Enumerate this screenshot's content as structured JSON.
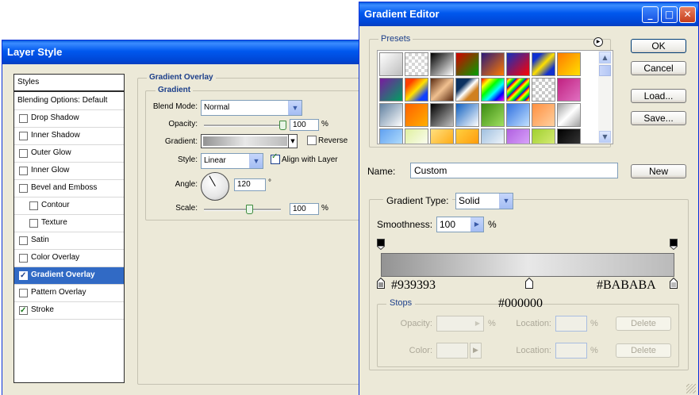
{
  "layer_style": {
    "title": "Layer Style",
    "list": [
      {
        "label": "Styles",
        "checkbox": false,
        "checked": false,
        "selected": false,
        "indent": 0,
        "header": true
      },
      {
        "label": "Blending Options: Default",
        "checkbox": false,
        "checked": false,
        "selected": false,
        "indent": 0,
        "header": false
      },
      {
        "label": "Drop Shadow",
        "checkbox": true,
        "checked": false,
        "selected": false,
        "indent": 0,
        "header": false
      },
      {
        "label": "Inner Shadow",
        "checkbox": true,
        "checked": false,
        "selected": false,
        "indent": 0,
        "header": false
      },
      {
        "label": "Outer Glow",
        "checkbox": true,
        "checked": false,
        "selected": false,
        "indent": 0,
        "header": false
      },
      {
        "label": "Inner Glow",
        "checkbox": true,
        "checked": false,
        "selected": false,
        "indent": 0,
        "header": false
      },
      {
        "label": "Bevel and Emboss",
        "checkbox": true,
        "checked": false,
        "selected": false,
        "indent": 0,
        "header": false
      },
      {
        "label": "Contour",
        "checkbox": true,
        "checked": false,
        "selected": false,
        "indent": 1,
        "header": false
      },
      {
        "label": "Texture",
        "checkbox": true,
        "checked": false,
        "selected": false,
        "indent": 1,
        "header": false
      },
      {
        "label": "Satin",
        "checkbox": true,
        "checked": false,
        "selected": false,
        "indent": 0,
        "header": false
      },
      {
        "label": "Color Overlay",
        "checkbox": true,
        "checked": false,
        "selected": false,
        "indent": 0,
        "header": false
      },
      {
        "label": "Gradient Overlay",
        "checkbox": true,
        "checked": true,
        "selected": true,
        "indent": 0,
        "header": false
      },
      {
        "label": "Pattern Overlay",
        "checkbox": true,
        "checked": false,
        "selected": false,
        "indent": 0,
        "header": false
      },
      {
        "label": "Stroke",
        "checkbox": true,
        "checked": true,
        "selected": false,
        "indent": 0,
        "header": false
      }
    ],
    "section_title": "Gradient Overlay",
    "group_title": "Gradient",
    "blend_mode_label": "Blend Mode:",
    "blend_mode_value": "Normal",
    "opacity_label": "Opacity:",
    "opacity_value": "100",
    "opacity_unit": "%",
    "opacity_level": 1.0,
    "gradient_label": "Gradient:",
    "reverse_label": "Reverse",
    "reverse_checked": false,
    "style_label": "Style:",
    "style_value": "Linear",
    "align_label": "Align with Layer",
    "align_checked": true,
    "angle_label": "Angle:",
    "angle_value": "120",
    "angle_unit": "°",
    "scale_label": "Scale:",
    "scale_value": "100",
    "scale_unit": "%",
    "scale_level": 0.6
  },
  "gradient_editor": {
    "title": "Gradient Editor",
    "title_buttons": {
      "minimize": "_",
      "maximize": "□",
      "close": "✕"
    },
    "presets_label": "Presets",
    "buttons": {
      "ok": "OK",
      "cancel": "Cancel",
      "load": "Load...",
      "save": "Save...",
      "new": "New"
    },
    "name_label": "Name:",
    "name_value": "Custom",
    "gradient_type_label": "Gradient Type:",
    "gradient_type_value": "Solid",
    "smoothness_label": "Smoothness:",
    "smoothness_value": "100",
    "smoothness_unit": "%",
    "stop_labels": {
      "left": "#939393",
      "middle": "#000000",
      "right": "#BABABA"
    },
    "stops_group_label": "Stops",
    "stops": {
      "opacity_label": "Opacity:",
      "opacity_unit": "%",
      "location_label": "Location:",
      "location_unit": "%",
      "delete_label": "Delete",
      "color_label": "Color:"
    },
    "gradient_colors": {
      "left": "#939393",
      "middle": "#e8e8e8",
      "right": "#bababa"
    },
    "presets": [
      "linear-gradient(135deg,#ffffff,#bdbdbd)",
      "repeating-conic-gradient(#d6d6d6 0 25%,#ffffff 0 50%) 0 0/8px 8px",
      "linear-gradient(135deg,#000000,#ffffff)",
      "linear-gradient(135deg,#d40000,#00a000)",
      "linear-gradient(135deg,#2a1a7a,#ff7a00)",
      "linear-gradient(135deg,#1030c0,#ff0000)",
      "linear-gradient(135deg,#1030d0 20%,#ffe000 50%,#1030d0 80%)",
      "linear-gradient(135deg,#ff7a00,#ffe000)",
      "linear-gradient(135deg,#7a1aa0,#00a060)",
      "linear-gradient(135deg,#ff4000 20%,#ffe000 50%,#1040ff 80%)",
      "linear-gradient(135deg,#5a2a10,#f0c090,#5a2a10)",
      "linear-gradient(135deg,#0a3060 30%,#ffffff 50%,#d08020 70%)",
      "linear-gradient(135deg,#ff0000,#ffff00,#00ff00,#00ffff,#0000ff,#ff00ff)",
      "repeating-linear-gradient(135deg,#ff0000 0,#ffff00 3px,#00ff00 6px,#0000ff 9px)",
      "repeating-conic-gradient(#c8c8c8 0 25%,#ffffff 0 50%) 0 0/8px 8px",
      "linear-gradient(135deg,#c02080,#e070c0)",
      "linear-gradient(135deg,#6080a0,#ffffff)",
      "linear-gradient(135deg,#ff6000,#ffb000)",
      "linear-gradient(135deg,#000000,#c0c0c0)",
      "linear-gradient(135deg,#1060c0,#ffffff)",
      "linear-gradient(135deg,#3a8a10,#a0e060)",
      "linear-gradient(135deg,#3070e0,#c0e0ff)",
      "linear-gradient(135deg,#ff9040,#ffd0a0)",
      "linear-gradient(135deg,#a0a0a0,#ffffff,#a0a0a0)",
      "linear-gradient(135deg,#60a0f0,#c0e8ff)",
      "linear-gradient(135deg,#e0f0a0,#ffffff)",
      "linear-gradient(135deg,#ffe080,#ffa000)",
      "linear-gradient(135deg,#ffd040,#ff9000)",
      "linear-gradient(135deg,#a0c0e0,#ffffff)",
      "linear-gradient(135deg,#b060e0,#e0b0ff)",
      "linear-gradient(135deg,#a0d030,#e0f080)",
      "linear-gradient(135deg,#000000,#404040)"
    ]
  }
}
